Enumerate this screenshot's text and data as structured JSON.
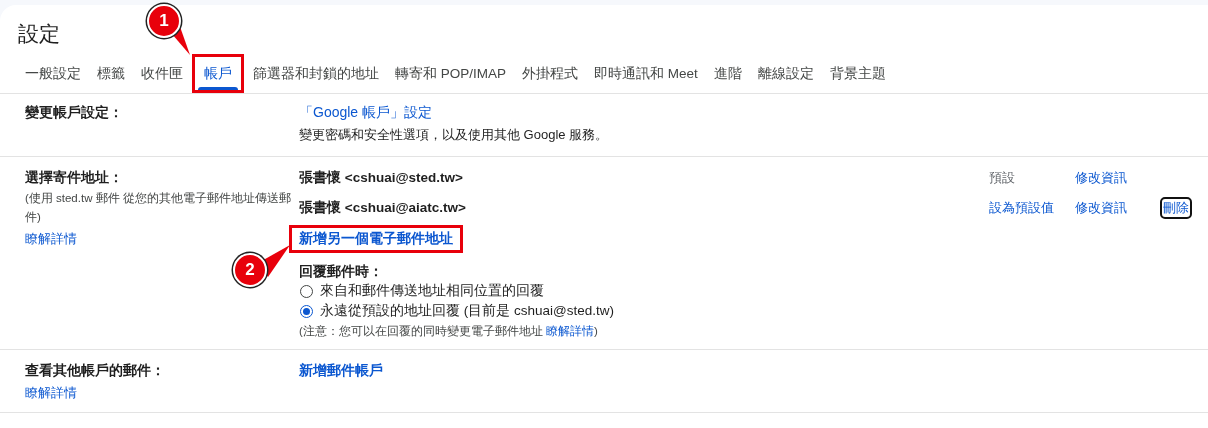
{
  "title": "設定",
  "tabs": [
    {
      "label": "一般設定",
      "selected": false,
      "highlighted": false
    },
    {
      "label": "標籤",
      "selected": false,
      "highlighted": false
    },
    {
      "label": "收件匣",
      "selected": false,
      "highlighted": false
    },
    {
      "label": "帳戶",
      "selected": true,
      "highlighted": true
    },
    {
      "label": "篩選器和封鎖的地址",
      "selected": false,
      "highlighted": false
    },
    {
      "label": "轉寄和 POP/IMAP",
      "selected": false,
      "highlighted": false
    },
    {
      "label": "外掛程式",
      "selected": false,
      "highlighted": false
    },
    {
      "label": "即時通訊和 Meet",
      "selected": false,
      "highlighted": false
    },
    {
      "label": "進階",
      "selected": false,
      "highlighted": false
    },
    {
      "label": "離線設定",
      "selected": false,
      "highlighted": false
    },
    {
      "label": "背景主題",
      "selected": false,
      "highlighted": false
    }
  ],
  "change_account": {
    "label": "變更帳戶設定：",
    "link": "「Google 帳戶」設定",
    "description": "變更密碼和安全性選項，以及使用其他 Google 服務。"
  },
  "send_as": {
    "label": "選擇寄件地址：",
    "description": "(使用 sted.tw 郵件 從您的其他電子郵件地址傳送郵件)",
    "learn_more": "瞭解詳情",
    "addresses": [
      {
        "address": "張書懷 <cshuai@sted.tw>",
        "default": true,
        "status": "預設",
        "edit": "修改資訊"
      },
      {
        "address": "張書懷 <cshuai@aiatc.tw>",
        "default": false,
        "status": "設為預設值",
        "edit": "修改資訊",
        "delete": "刪除",
        "focused": true
      }
    ],
    "add_link": "新增另一個電子郵件地址",
    "add_highlighted": true,
    "reply_label": "回覆郵件時：",
    "reply_options": [
      {
        "label": "來自和郵件傳送地址相同位置的回覆",
        "selected": false
      },
      {
        "label": "永遠從預設的地址回覆 (目前是 cshuai@sted.tw)",
        "selected": true
      }
    ],
    "note_before": "(注意：您可以在回覆的同時變更電子郵件地址 ",
    "note_link": "瞭解詳情",
    "note_after": ")"
  },
  "check_mail": {
    "label": "查看其他帳戶的郵件：",
    "learn_more": "瞭解詳情",
    "link": "新增郵件帳戶"
  },
  "callouts": [
    {
      "label": "1"
    },
    {
      "label": "2"
    }
  ]
}
